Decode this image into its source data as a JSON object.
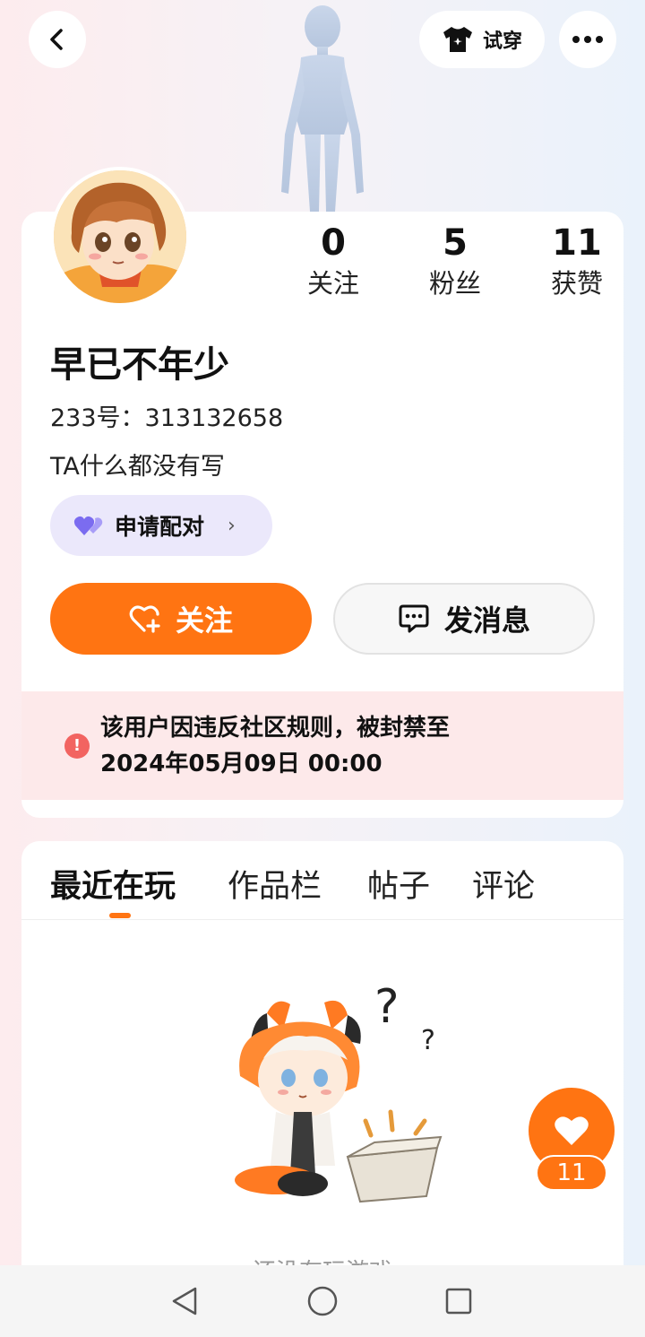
{
  "header": {
    "tryon_label": "试穿",
    "icons": {
      "back": "back-arrow-icon",
      "tryon": "tshirt-icon",
      "more": "more-dots-icon"
    }
  },
  "profile": {
    "stats": [
      {
        "value": "0",
        "label": "关注"
      },
      {
        "value": "5",
        "label": "粉丝"
      },
      {
        "value": "11",
        "label": "获赞"
      }
    ],
    "username": "早已不年少",
    "uid": "233号：313132658",
    "bio": "TA什么都没有写",
    "pair_label": "申请配对",
    "follow_label": "关注",
    "message_label": "发消息",
    "ban_line1": "该用户因违反社区规则，被封禁至",
    "ban_line2": "2024年05月09日 00:00"
  },
  "tabs": [
    {
      "label": "最近在玩",
      "active": true
    },
    {
      "label": "作品栏",
      "active": false
    },
    {
      "label": "帖子",
      "active": false
    },
    {
      "label": "评论",
      "active": false
    }
  ],
  "empty_state_text": "还没有玩游戏",
  "fab": {
    "likes": "11"
  },
  "colors": {
    "accent": "#ff7412",
    "pair_bg": "#ebe8fb",
    "ban_bg": "#fde9ea",
    "ban_icon": "#f26461"
  }
}
